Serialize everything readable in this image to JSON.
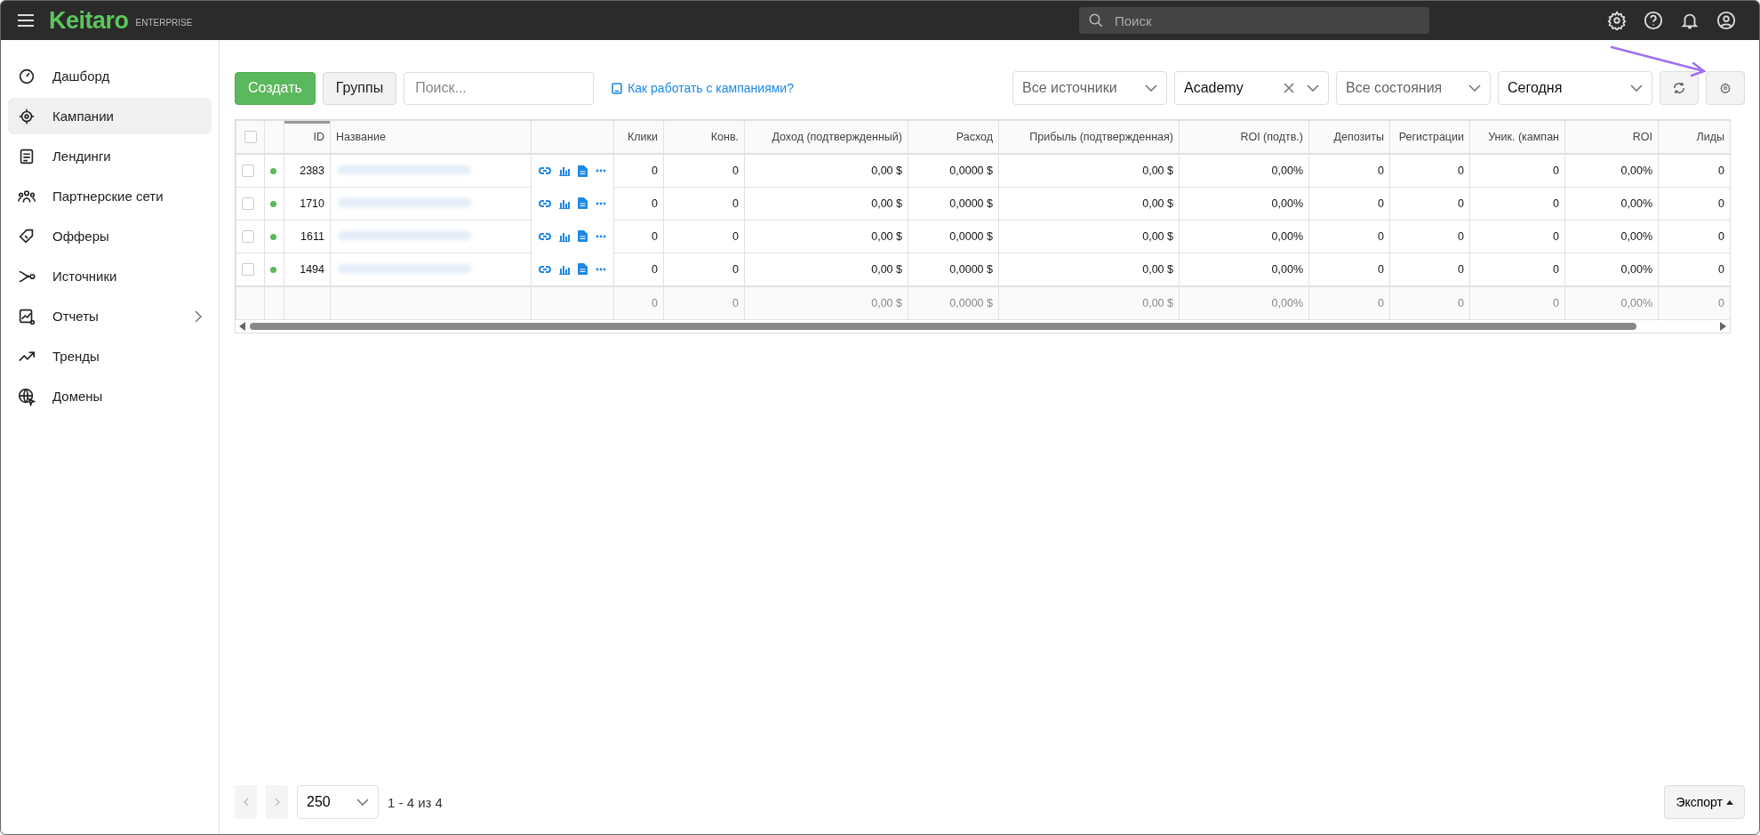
{
  "topbar": {
    "logo": "Keitaro",
    "edition": "ENTERPRISE",
    "search": {
      "placeholder": "Поиск"
    }
  },
  "sidebar": {
    "items": [
      {
        "label": "Дашборд",
        "selected": false,
        "expandable": false
      },
      {
        "label": "Кампании",
        "selected": true,
        "expandable": false
      },
      {
        "label": "Лендинги",
        "selected": false,
        "expandable": false
      },
      {
        "label": "Партнерские сети",
        "selected": false,
        "expandable": false
      },
      {
        "label": "Офферы",
        "selected": false,
        "expandable": false
      },
      {
        "label": "Источники",
        "selected": false,
        "expandable": false
      },
      {
        "label": "Отчеты",
        "selected": false,
        "expandable": true
      },
      {
        "label": "Тренды",
        "selected": false,
        "expandable": false
      },
      {
        "label": "Домены",
        "selected": false,
        "expandable": false
      }
    ]
  },
  "toolbar": {
    "create_button": "Создать",
    "groups_button": "Группы",
    "search": {
      "placeholder": "Поиск..."
    },
    "help_link": "Как работать с кампаниями?",
    "filters": [
      {
        "kind": "placeholder",
        "text": "Все источники",
        "clearable": false
      },
      {
        "kind": "value",
        "text": "Academy",
        "clearable": true
      },
      {
        "kind": "placeholder",
        "text": "Все состояния",
        "clearable": false
      },
      {
        "kind": "value",
        "text": "Сегодня",
        "clearable": false
      }
    ]
  },
  "table": {
    "select_all_checked": false,
    "columns": [
      "ID",
      "Название",
      "",
      "Клики",
      "Конв.",
      "Доход (подтвержденный)",
      "Расход",
      "Прибыль (подтвержденная)",
      "ROI (подтв.)",
      "Депозиты",
      "Регистрации",
      "Уник. (кампан",
      "ROI",
      "Лиды"
    ],
    "rows": [
      {
        "checked": false,
        "color": "#5cb85c",
        "id": "2383",
        "values": [
          "0",
          "0",
          "0,00 $",
          "0,0000 $",
          "0,00 $",
          "0,00%",
          "0",
          "0",
          "0",
          "0,00%",
          "0"
        ]
      },
      {
        "checked": false,
        "color": "#5cb85c",
        "id": "1710",
        "values": [
          "0",
          "0",
          "0,00 $",
          "0,0000 $",
          "0,00 $",
          "0,00%",
          "0",
          "0",
          "0",
          "0,00%",
          "0"
        ]
      },
      {
        "checked": false,
        "color": "#5cb85c",
        "id": "1611",
        "values": [
          "0",
          "0",
          "0,00 $",
          "0,0000 $",
          "0,00 $",
          "0,00%",
          "0",
          "0",
          "0",
          "0,00%",
          "0"
        ]
      },
      {
        "checked": false,
        "color": "#5cb85c",
        "id": "1494",
        "values": [
          "0",
          "0",
          "0,00 $",
          "0,0000 $",
          "0,00 $",
          "0,00%",
          "0",
          "0",
          "0",
          "0,00%",
          "0"
        ]
      }
    ],
    "totals": [
      "0",
      "0",
      "0,00 $",
      "0,0000 $",
      "0,00 $",
      "0,00%",
      "0",
      "0",
      "0",
      "0,00%",
      "0"
    ]
  },
  "pagination": {
    "per_page": "250",
    "range": "1 - 4 из 4"
  },
  "export_button": "Экспорт"
}
